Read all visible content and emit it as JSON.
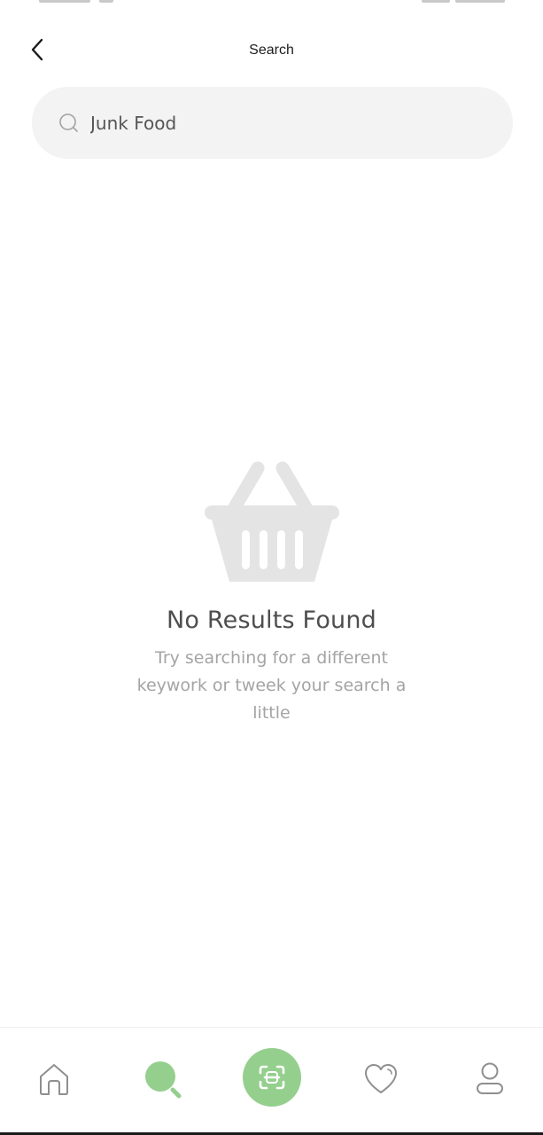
{
  "header": {
    "title": "Search"
  },
  "search": {
    "value": "Junk Food"
  },
  "empty_state": {
    "title": "No Results Found",
    "message": "Try searching for a different keywork or tweek your search a little",
    "icon": "basket-icon"
  },
  "bottom_nav": {
    "items": [
      {
        "icon": "home-icon"
      },
      {
        "icon": "search-icon",
        "active": true
      },
      {
        "icon": "scan-icon"
      },
      {
        "icon": "heart-icon"
      },
      {
        "icon": "profile-icon"
      }
    ]
  },
  "colors": {
    "accent": "#95cf8e",
    "search_bg": "#f3f3f3",
    "empty_icon": "#e4e4e4",
    "muted_text": "#a4a4a4"
  }
}
